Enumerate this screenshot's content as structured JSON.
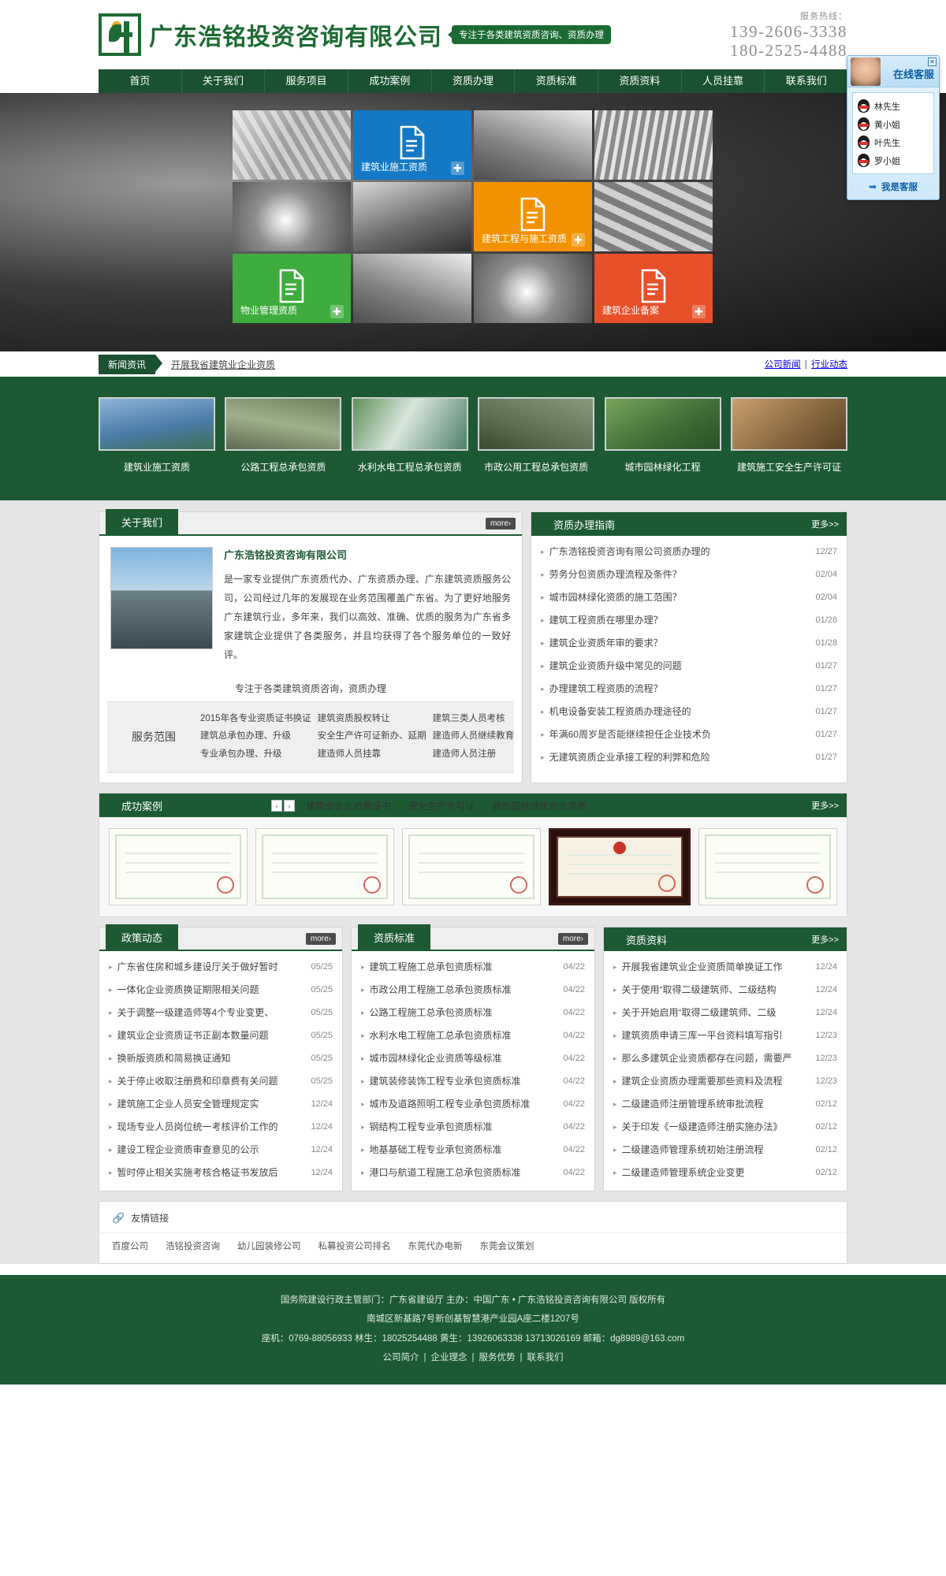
{
  "header": {
    "company_name": "广东浩铭投资咨询有限公司",
    "tagline": "专注于各类建筑资质咨询、资质办理",
    "hotline_label": "服务热线：",
    "hotline_1": "139-2606-3338",
    "hotline_2": "180-2525-4488"
  },
  "nav": {
    "items": [
      {
        "label": "首页"
      },
      {
        "label": "关于我们"
      },
      {
        "label": "服务项目"
      },
      {
        "label": "成功案例"
      },
      {
        "label": "资质办理"
      },
      {
        "label": "资质标准"
      },
      {
        "label": "资质资料"
      },
      {
        "label": "人员挂靠"
      },
      {
        "label": "联系我们"
      }
    ]
  },
  "banner": {
    "tiles": [
      {
        "type": "photo",
        "variant": "v1"
      },
      {
        "type": "color",
        "label": "建筑业施工资质",
        "color": "#1479c4",
        "plus": "✚"
      },
      {
        "type": "photo",
        "variant": "v2"
      },
      {
        "type": "photo",
        "variant": "v3"
      },
      {
        "type": "photo",
        "variant": "v4"
      },
      {
        "type": "photo",
        "variant": "v5"
      },
      {
        "type": "color",
        "label": "建筑工程与施工资质",
        "color": "#f39200",
        "plus": "✚"
      },
      {
        "type": "photo",
        "variant": "v6"
      },
      {
        "type": "color",
        "label": "物业管理资质",
        "color": "#3eac3e",
        "plus": "✚"
      },
      {
        "type": "photo",
        "variant": "v2"
      },
      {
        "type": "photo",
        "variant": "v4"
      },
      {
        "type": "color",
        "label": "建筑企业备案",
        "color": "#e8502a",
        "plus": "✚"
      }
    ]
  },
  "qq_widget": {
    "title": "在线客服",
    "close": "✕",
    "agents": [
      "林先生",
      "黄小姐",
      "叶先生",
      "罗小姐"
    ],
    "footer_label": "我是客服",
    "arrow": "➡"
  },
  "news_strip": {
    "tag": "新闻资讯",
    "headline": "开展我省建筑业企业资质",
    "link_1": "公司新闻",
    "separator": "|",
    "link_2": "行业动态"
  },
  "green_cards": [
    {
      "label": "建筑业施工资质",
      "thumb": "t1"
    },
    {
      "label": "公路工程总承包资质",
      "thumb": "t2"
    },
    {
      "label": "水利水电工程总承包资质",
      "thumb": "t3"
    },
    {
      "label": "市政公用工程总承包资质",
      "thumb": "t4"
    },
    {
      "label": "城市园林绿化工程",
      "thumb": "t5"
    },
    {
      "label": "建筑施工安全生产许可证",
      "thumb": "t6"
    }
  ],
  "about": {
    "title": "关于我们",
    "more": "more›",
    "company": "广东浩铭投资咨询有限公司",
    "body": "是一家专业提供广东资质代办、广东资质办理、广东建筑资质服务公司，公司经过几年的发展现在业务范围覆盖广东省。为了更好地服务广东建筑行业，多年来，我们以高效、准确、优质的服务为广东省多家建筑企业提供了各类服务，并且均获得了各个服务单位的一致好评。",
    "scope_slogan": "专注于各类建筑资质咨询，资质办理",
    "scope_name": "服务范围",
    "scope_col1": [
      "2015年各专业资质证书换证",
      "建筑总承包办理、升级",
      "专业承包办理、升级"
    ],
    "scope_col2": [
      "建筑资质股权转让",
      "安全生产许可证新办、延期",
      "建造师人员挂靠"
    ],
    "scope_col3": [
      "建筑三类人员考核",
      "建造师人员继续教育",
      "建造师人员注册"
    ]
  },
  "guide": {
    "title": "资质办理指南",
    "more": "更多>>",
    "items": [
      {
        "text": "广东浩铭投资咨询有限公司资质办理的",
        "date": "12/27"
      },
      {
        "text": "劳务分包资质办理流程及条件？",
        "date": "02/04"
      },
      {
        "text": "城市园林绿化资质的施工范围？",
        "date": "02/04"
      },
      {
        "text": "建筑工程资质在哪里办理？",
        "date": "01/28"
      },
      {
        "text": "建筑企业资质年审的要求？",
        "date": "01/28"
      },
      {
        "text": "建筑企业资质升级中常见的问题",
        "date": "01/27"
      },
      {
        "text": "办理建筑工程资质的流程？",
        "date": "01/27"
      },
      {
        "text": "机电设备安装工程资质办理途径的",
        "date": "01/27"
      },
      {
        "text": "年满60周岁是否能继续担任企业技术负",
        "date": "01/27"
      },
      {
        "text": "无建筑资质企业承接工程的利弊和危险",
        "date": "01/27"
      }
    ]
  },
  "cases": {
    "title": "成功案例",
    "prev": "‹",
    "next": "›",
    "more": "更多>>",
    "tabs": [
      "建筑业企业资质证书",
      "安全生产许可证",
      "城市园林绿化企业资质"
    ],
    "certificates": [
      {
        "style": "light"
      },
      {
        "style": "light"
      },
      {
        "style": "light"
      },
      {
        "style": "dark"
      },
      {
        "style": "light"
      }
    ]
  },
  "policy": {
    "title": "政策动态",
    "more": "more›",
    "items": [
      {
        "text": "广东省住房和城乡建设厅关于做好暂时",
        "date": "05/25"
      },
      {
        "text": "一体化企业资质换证期限相关问题",
        "date": "05/25"
      },
      {
        "text": "关于调整一级建造师等4个专业变更、",
        "date": "05/25"
      },
      {
        "text": "建筑业企业资质证书正副本数量问题",
        "date": "05/25"
      },
      {
        "text": "换新版资质和简易换证通知",
        "date": "05/25"
      },
      {
        "text": "关于停止收取注册费和印章费有关问题",
        "date": "05/25"
      },
      {
        "text": "建筑施工企业人员安全管理规定实",
        "date": "12/24"
      },
      {
        "text": "现场专业人员岗位统一考核评价工作的",
        "date": "12/24"
      },
      {
        "text": "建设工程企业资质审查意见的公示",
        "date": "12/24"
      },
      {
        "text": "暂时停止相关实施考核合格证书发放后",
        "date": "12/24"
      }
    ]
  },
  "standard": {
    "title": "资质标准",
    "more": "more›",
    "items": [
      {
        "text": "建筑工程施工总承包资质标准",
        "date": "04/22"
      },
      {
        "text": "市政公用工程施工总承包资质标准",
        "date": "04/22"
      },
      {
        "text": "公路工程施工总承包资质标准",
        "date": "04/22"
      },
      {
        "text": "水利水电工程施工总承包资质标准",
        "date": "04/22"
      },
      {
        "text": "城市园林绿化企业资质等级标准",
        "date": "04/22"
      },
      {
        "text": "建筑装修装饰工程专业承包资质标准",
        "date": "04/22"
      },
      {
        "text": "城市及道路照明工程专业承包资质标准",
        "date": "04/22"
      },
      {
        "text": "钢结构工程专业承包资质标准",
        "date": "04/22"
      },
      {
        "text": "地基基础工程专业承包资质标准",
        "date": "04/22"
      },
      {
        "text": "港口与航道工程施工总承包资质标准",
        "date": "04/22"
      }
    ]
  },
  "material": {
    "title": "资质资料",
    "more": "更多>>",
    "items": [
      {
        "text": "开展我省建筑业企业资质简单换证工作",
        "date": "12/24"
      },
      {
        "text": "关于使用“取得二级建筑师、二级结构",
        "date": "12/24"
      },
      {
        "text": "关于开始启用“取得二级建筑师、二级",
        "date": "12/24"
      },
      {
        "text": "建筑资质申请三库一平台资料填写指引",
        "date": "12/23"
      },
      {
        "text": "那么多建筑企业资质都存在问题，需要严",
        "date": "12/23"
      },
      {
        "text": "建筑企业资质办理需要那些资料及流程",
        "date": "12/23"
      },
      {
        "text": "二级建造师注册管理系统审批流程",
        "date": "02/12"
      },
      {
        "text": "关于印发《一级建造师注册实施办法》",
        "date": "02/12"
      },
      {
        "text": "二级建造师管理系统初始注册流程",
        "date": "02/12"
      },
      {
        "text": "二级建造师管理系统企业变更",
        "date": "02/12"
      }
    ]
  },
  "friend_links": {
    "title": "友情链接",
    "icon": "link-icon",
    "items": [
      "百度公司",
      "浩铭投资咨询",
      "幼儿园装修公司",
      "私募投资公司排名",
      "东莞代办电新",
      "东莞会议策划"
    ]
  },
  "footer": {
    "line1": "国务院建设行政主管部门：广东省建设厅 主办：中国广东 • 广东浩铭投资咨询有限公司 版权所有",
    "line2": "南城区新基路7号新创基智慧港产业园A座二楼1207号",
    "line3": "座机：0769-88056933 林生：18025254488 黄生：13926063338 13713026169 邮箱：dg8989@163.com",
    "bottom_links": [
      "公司简介",
      "企业理念",
      "服务优势",
      "联系我们"
    ],
    "separator": "|"
  }
}
